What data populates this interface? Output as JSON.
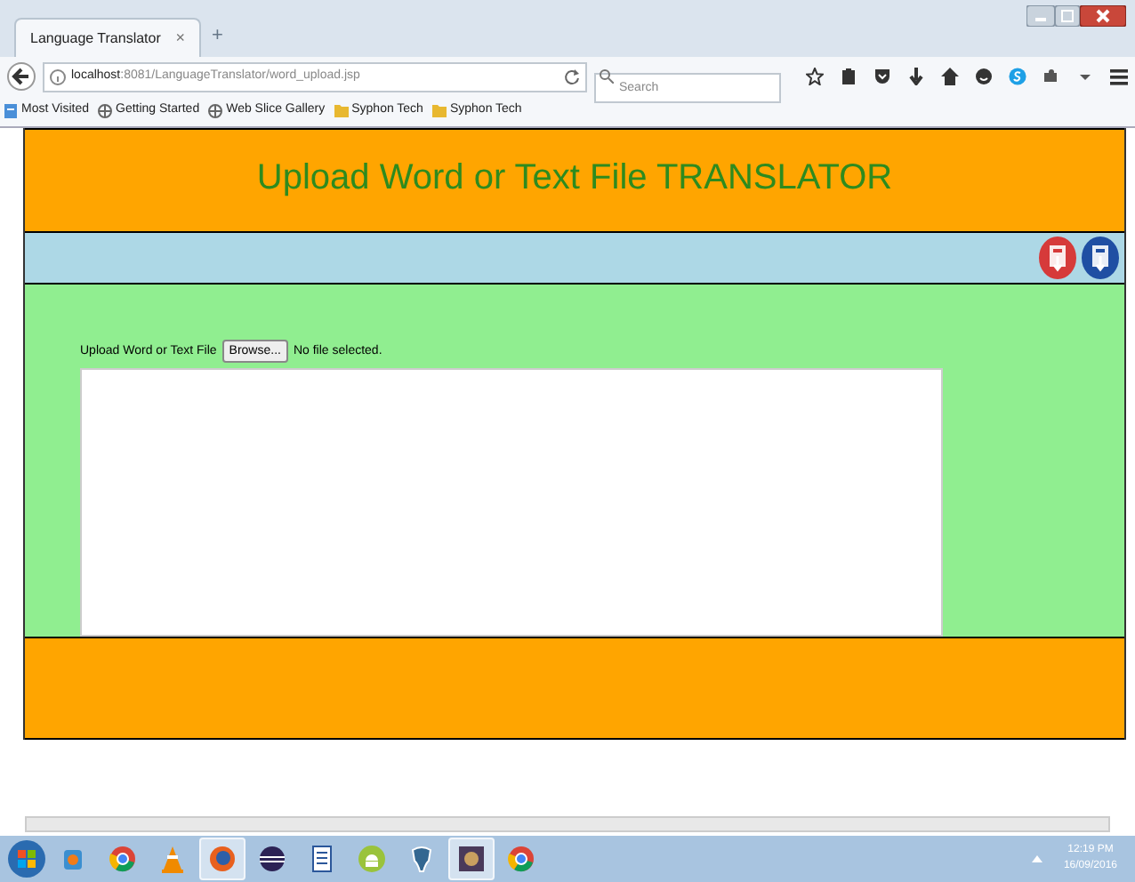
{
  "browser": {
    "tab_title": "Language Translator",
    "tab_close": "×",
    "new_tab": "+",
    "url_host": "localhost",
    "url_path": ":8081/LanguageTranslator/word_upload.jsp",
    "search_placeholder": "Search"
  },
  "bookmarks": [
    {
      "label": "Most Visited",
      "kind": "page"
    },
    {
      "label": "Getting Started",
      "kind": "globe"
    },
    {
      "label": "Web Slice Gallery",
      "kind": "globe"
    },
    {
      "label": "Syphon Tech",
      "kind": "folder"
    },
    {
      "label": "Syphon Tech",
      "kind": "folder"
    }
  ],
  "page": {
    "title": "Upload Word or Text File TRANSLATOR",
    "upload_label": "Upload Word or Text File",
    "browse_button": "Browse...",
    "file_status": "No file selected."
  },
  "taskbar": {
    "apps": [
      {
        "kind": "player",
        "selected": false
      },
      {
        "kind": "chrome",
        "selected": false
      },
      {
        "kind": "vlc",
        "selected": false
      },
      {
        "kind": "firefox",
        "selected": true
      },
      {
        "kind": "eclipse",
        "selected": false
      },
      {
        "kind": "word",
        "selected": false
      },
      {
        "kind": "android",
        "selected": false
      },
      {
        "kind": "elephant",
        "selected": false
      },
      {
        "kind": "app",
        "selected": true
      },
      {
        "kind": "chrome",
        "selected": false
      }
    ],
    "time": "12:19 PM",
    "date": "16/09/2016"
  }
}
